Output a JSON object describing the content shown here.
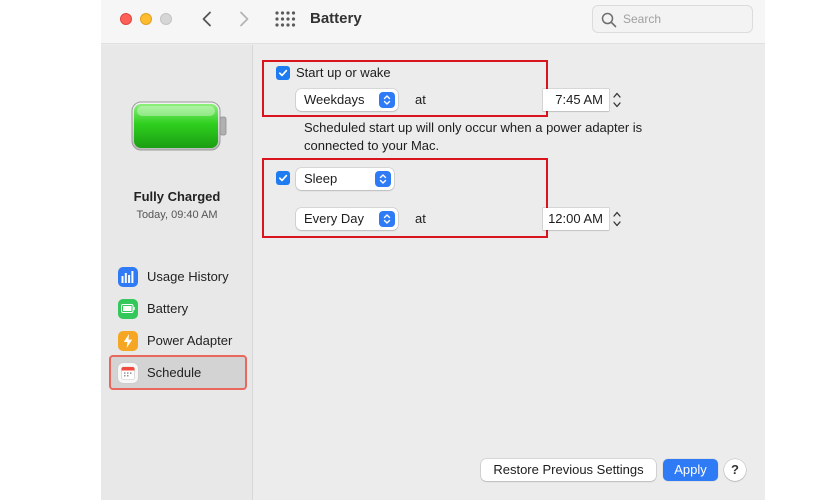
{
  "window": {
    "title": "Battery"
  },
  "search": {
    "placeholder": "Search"
  },
  "battery_status": {
    "title": "Fully Charged",
    "time": "Today, 09:40 AM",
    "level_percent": 100
  },
  "sidebar": {
    "items": [
      {
        "label": "Usage History",
        "icon": "usage-history-icon"
      },
      {
        "label": "Battery",
        "icon": "battery-icon"
      },
      {
        "label": "Power Adapter",
        "icon": "power-adapter-icon"
      },
      {
        "label": "Schedule",
        "icon": "calendar-icon",
        "selected": true
      }
    ]
  },
  "schedule": {
    "startup": {
      "checked": true,
      "label": "Start up or wake",
      "days": "Weekdays",
      "at_label": "at",
      "time": "7:45 AM",
      "note": "Scheduled start up will only occur when a power adapter is connected to your Mac."
    },
    "sleep": {
      "checked": true,
      "action": "Sleep",
      "days": "Every Day",
      "at_label": "at",
      "time": "12:00 AM"
    }
  },
  "footer": {
    "restore_label": "Restore Previous Settings",
    "apply_label": "Apply",
    "help_label": "?"
  },
  "colors": {
    "accent": "#2f7bf5",
    "highlight_box": "#d9141e",
    "battery_green": "#27c93f"
  }
}
